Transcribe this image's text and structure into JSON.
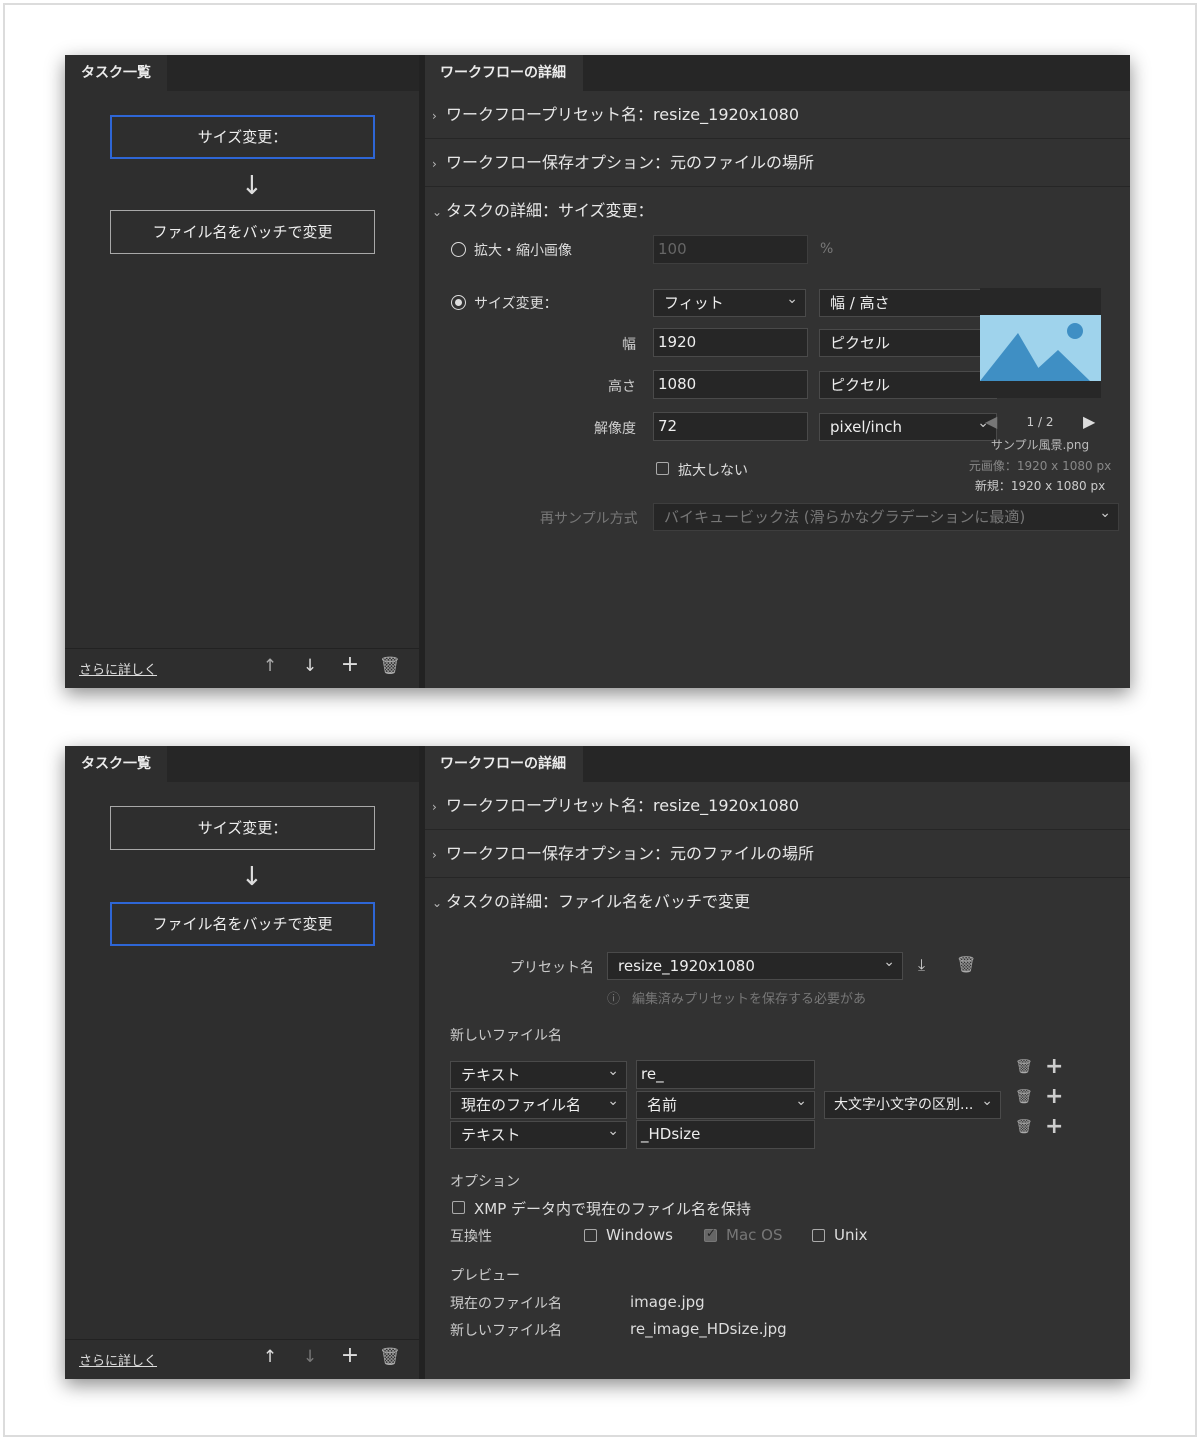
{
  "panels": [
    {
      "left_tab": "タスク一覧",
      "right_tab": "ワークフローの詳細",
      "tasks": [
        "サイズ変更：",
        "ファイル名をバッチで変更"
      ],
      "footer_link": "さらに詳しく",
      "sections": {
        "preset": "ワークフロープリセット名：resize_1920x1080",
        "save": "ワークフロー保存オプション：元のファイルの場所",
        "task": "タスクの詳細：サイズ変更："
      },
      "resize": {
        "scale_label": "拡大・縮小画像",
        "scale_value": "100",
        "percent": "%",
        "size_label": "サイズ変更：",
        "fit": "フィット",
        "wh": "幅 / 高さ",
        "width_label": "幅",
        "width_value": "1920",
        "width_unit": "ピクセル",
        "height_label": "高さ",
        "height_value": "1080",
        "height_unit": "ピクセル",
        "res_label": "解像度",
        "res_value": "72",
        "res_unit": "pixel/inch",
        "no_enlarge": "拡大しない",
        "resample_label": "再サンプル方式",
        "resample_value": "バイキュービック法 (滑らかなグラデーションに最適)"
      },
      "preview": {
        "page": "1 / 2",
        "filename": "サンプル風景.png",
        "original": "元画像：1920 x 1080 px",
        "new": "新規：1920 x 1080 px"
      }
    },
    {
      "left_tab": "タスク一覧",
      "right_tab": "ワークフローの詳細",
      "tasks": [
        "サイズ変更：",
        "ファイル名をバッチで変更"
      ],
      "footer_link": "さらに詳しく",
      "sections": {
        "preset": "ワークフロープリセット名：resize_1920x1080",
        "save": "ワークフロー保存オプション：元のファイルの場所",
        "task": "タスクの詳細：ファイル名をバッチで変更"
      },
      "rename": {
        "preset_label": "プリセット名",
        "preset_value": "resize_1920x1080",
        "info": "編集済みプリセットを保存する必要があ",
        "new_name_label": "新しいファイル名",
        "rows": [
          {
            "type": "テキスト",
            "value": "re_"
          },
          {
            "type": "現在のファイル名",
            "value": "名前",
            "extra": "大文字小文字の区別..."
          },
          {
            "type": "テキスト",
            "value": "_HDsize"
          }
        ],
        "options_label": "オプション",
        "xmp": "XMP データ内で現在のファイル名を保持",
        "compat_label": "互換性",
        "compat": [
          "Windows",
          "Mac OS",
          "Unix"
        ],
        "preview_label": "プレビュー",
        "current_label": "現在のファイル名",
        "current_value": "image.jpg",
        "new_label": "新しいファイル名",
        "new_value": "re_image_HDsize.jpg"
      }
    }
  ],
  "colors": {
    "accent": "#2e66d6",
    "panel": "#323232",
    "sky": "#9fd3ec",
    "mountain": "#3f8fc4"
  }
}
